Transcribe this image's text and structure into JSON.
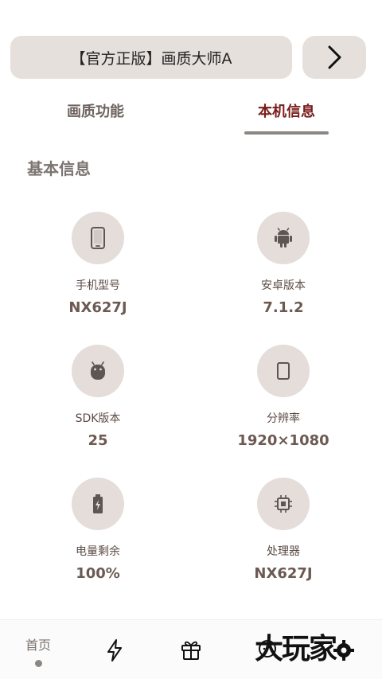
{
  "header": {
    "title": "【官方正版】画质大师A"
  },
  "tabs": [
    {
      "label": "画质功能",
      "active": false
    },
    {
      "label": "本机信息",
      "active": true
    }
  ],
  "section": {
    "title": "基本信息"
  },
  "info_items": [
    {
      "label": "手机型号",
      "value": "NX627J",
      "icon": "phone-icon"
    },
    {
      "label": "安卓版本",
      "value": "7.1.2",
      "icon": "android-icon"
    },
    {
      "label": "SDK版本",
      "value": "25",
      "icon": "android-head-icon"
    },
    {
      "label": "分辨率",
      "value": "1920×1080",
      "icon": "tablet-icon"
    },
    {
      "label": "电量剩余",
      "value": "100%",
      "icon": "battery-charging-icon"
    },
    {
      "label": "处理器",
      "value": "NX627J",
      "icon": "cpu-chip-icon"
    }
  ],
  "bottom_nav": {
    "home_label": "首页",
    "items": [
      "home",
      "lightning-icon",
      "gift-icon",
      "chat-icon",
      "settings-icon"
    ]
  },
  "watermark": {
    "text": "大玩家"
  },
  "colors": {
    "pill_bg": "#e6e0dc",
    "active_tab": "#7a1c1c",
    "circle_bg": "#e4ddd9",
    "icon": "#5e5653"
  }
}
